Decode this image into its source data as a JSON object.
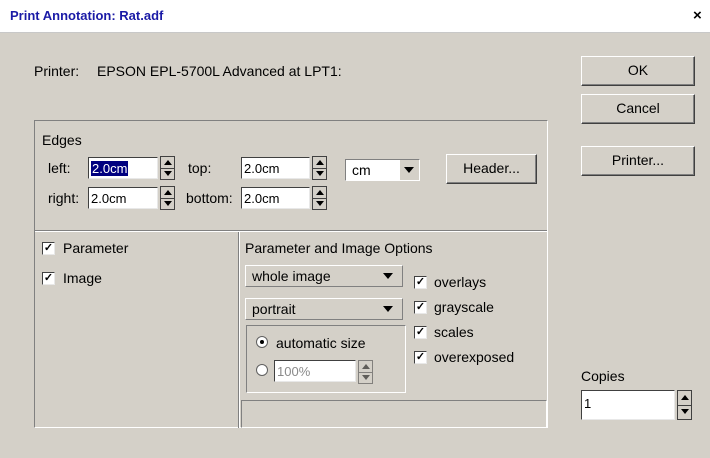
{
  "window": {
    "title": "Print Annotation: Rat.adf",
    "close": "×"
  },
  "printer": {
    "label": "Printer:",
    "name": "EPSON EPL-5700L Advanced at LPT1:"
  },
  "buttons": {
    "ok": "OK",
    "cancel": "Cancel",
    "printer": "Printer...",
    "header": "Header..."
  },
  "edges": {
    "title": "Edges",
    "left_label": "left:",
    "left_value": "2.0cm",
    "top_label": "top:",
    "top_value": "2.0cm",
    "right_label": "right:",
    "right_value": "2.0cm",
    "bottom_label": "bottom:",
    "bottom_value": "2.0cm",
    "unit": "cm"
  },
  "include": {
    "parameter": "Parameter",
    "image": "Image",
    "parameter_checked": true,
    "image_checked": true
  },
  "options": {
    "title": "Parameter and Image Options",
    "region": "whole image",
    "orientation": "portrait",
    "auto_size": "automatic size",
    "percent": "100%",
    "overlays": "overlays",
    "grayscale": "grayscale",
    "scales": "scales",
    "overexposed": "overexposed"
  },
  "copies": {
    "label": "Copies",
    "value": "1"
  },
  "icons": {
    "check": "✓",
    "close": "×"
  }
}
